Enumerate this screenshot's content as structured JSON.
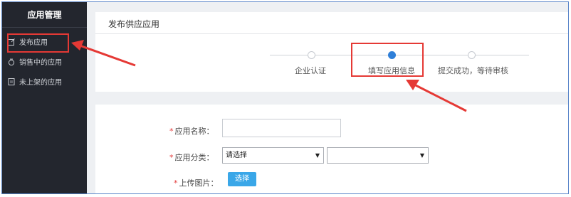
{
  "sidebar": {
    "title": "应用管理",
    "items": [
      {
        "label": "发布应用",
        "icon": "edit-icon"
      },
      {
        "label": "销售中的应用",
        "icon": "money-bag-icon"
      },
      {
        "label": "未上架的应用",
        "icon": "file-icon"
      }
    ]
  },
  "main": {
    "page_title": "发布供应应用",
    "steps": [
      {
        "label": "企业认证",
        "state": "done"
      },
      {
        "label": "填写应用信息",
        "state": "active"
      },
      {
        "label": "提交成功，等待审核",
        "state": "pending"
      }
    ]
  },
  "form": {
    "required_mark": "*",
    "name_label": "应用名称：",
    "name_value": "",
    "category_label": "应用分类：",
    "category_select_1": "请选择",
    "category_select_2": "",
    "upload_label": "上传图片：",
    "choose_button": "选择"
  },
  "colors": {
    "sidebar_bg": "#23262e",
    "accent_blue": "#2f7fd8",
    "button_blue": "#3aa7e8",
    "required_red": "#e33b3b",
    "annotation_red": "#e53935"
  }
}
